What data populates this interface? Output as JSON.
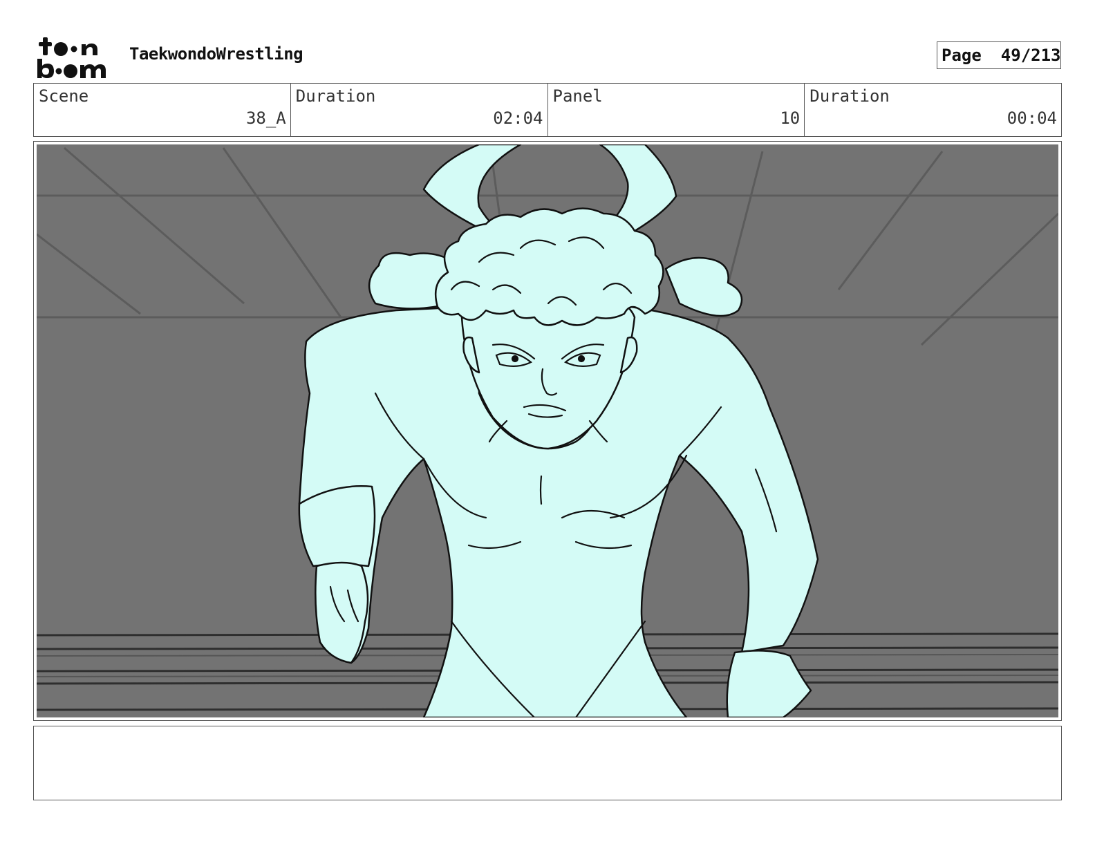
{
  "header": {
    "logo_line1": "toon",
    "logo_line2": "boom",
    "project_title": "TaekwondoWrestling",
    "page_label": "Page",
    "page_value": "49/213"
  },
  "info": {
    "scene_label": "Scene",
    "scene_value": "38_A",
    "scene_duration_label": "Duration",
    "scene_duration_value": "02:04",
    "panel_label": "Panel",
    "panel_value": "10",
    "panel_duration_label": "Duration",
    "panel_duration_value": "00:04"
  },
  "colors": {
    "character_fill": "#d4fbf6",
    "background_gray": "#737373",
    "line_color": "#111111"
  },
  "notes": {
    "text": ""
  }
}
